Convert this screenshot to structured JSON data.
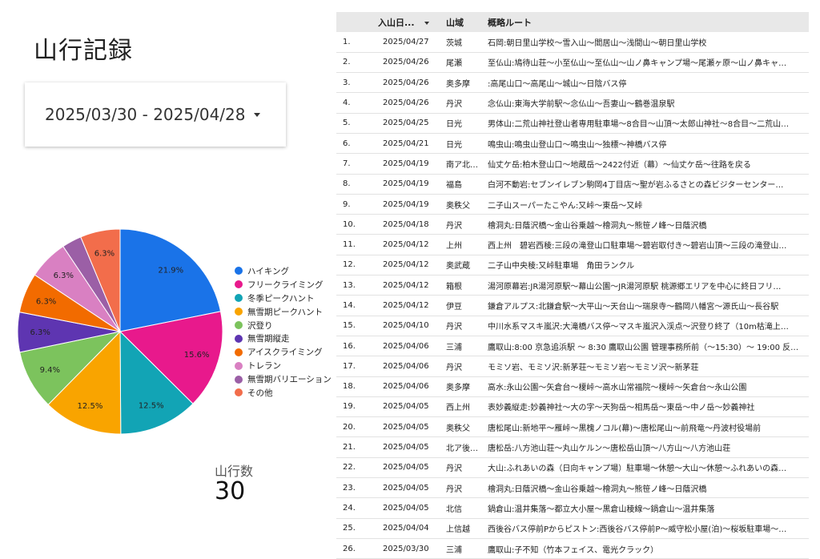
{
  "page": {
    "title": "山行記録"
  },
  "date_range": {
    "value": "2025/03/30 - 2025/04/28"
  },
  "summary": {
    "label": "山行数",
    "value": "30"
  },
  "chart_data": {
    "type": "pie",
    "slices": [
      {
        "name": "ハイキング",
        "value": 21.9,
        "label": "21.9%",
        "color": "#1a73e8"
      },
      {
        "name": "フリークライミング",
        "value": 15.6,
        "label": "15.6%",
        "color": "#e8198c"
      },
      {
        "name": "冬季ピークハント",
        "value": 12.5,
        "label": "12.5%",
        "color": "#12a4b5"
      },
      {
        "name": "無雪期ピークハント",
        "value": 12.5,
        "label": "12.5%",
        "color": "#f9a400"
      },
      {
        "name": "沢登り",
        "value": 9.4,
        "label": "9.4%",
        "color": "#7cc35d"
      },
      {
        "name": "無雪期縦走",
        "value": 6.3,
        "label": "6.3%",
        "color": "#5e35b1"
      },
      {
        "name": "アイスクライミング",
        "value": 6.3,
        "label": "6.3%",
        "color": "#f26b00"
      },
      {
        "name": "トレラン",
        "value": 6.3,
        "label": "6.3%",
        "color": "#d980c2"
      },
      {
        "name": "無雪期バリエーション",
        "value": 3.1,
        "label": "",
        "color": "#9b5fa6"
      },
      {
        "name": "その他",
        "value": 6.3,
        "label": "6.3%",
        "color": "#f26d4b"
      }
    ]
  },
  "table": {
    "headers": [
      "",
      "入山日...",
      "山域",
      "概略ルート"
    ],
    "rows": [
      [
        "1.",
        "2025/04/27",
        "茨城",
        "石岡:朝日里山学校〜雪入山〜閻居山〜浅間山〜朝日里山学校"
      ],
      [
        "2.",
        "2025/04/26",
        "尾瀬",
        "至仏山:鳩待山荘〜小至仏山〜至仏山〜山ノ鼻キャンプ場〜尾瀬ヶ原〜山ノ鼻キャ…"
      ],
      [
        "3.",
        "2025/04/26",
        "奥多摩",
        ":高尾山口〜高尾山〜城山〜日陰バス停"
      ],
      [
        "4.",
        "2025/04/26",
        "丹沢",
        "念仏山:東海大学前駅〜念仏山〜吾妻山〜鶴巻温泉駅"
      ],
      [
        "5.",
        "2025/04/25",
        "日光",
        "男体山:二荒山神社登山者専用駐車場〜8合目〜山頂〜太郎山神社〜8合目〜二荒山…"
      ],
      [
        "6.",
        "2025/04/21",
        "日光",
        "鳴虫山:鳴虫山登山口〜鳴虫山〜独標〜神橋バス停"
      ],
      [
        "7.",
        "2025/04/19",
        "南ア北…",
        "仙丈ケ岳:柏木登山口〜地蔵岳〜2422付近（幕）〜仙丈ケ岳〜往路を戻る"
      ],
      [
        "8.",
        "2025/04/19",
        "福島",
        "白河不動岩:セブンイレブン駒岡4丁目店〜聖が岩ふるさとの森ビジターセンター…"
      ],
      [
        "9.",
        "2025/04/19",
        "奥秩父",
        "二子山スーパーたこやん:又峠〜東岳〜又峠"
      ],
      [
        "10.",
        "2025/04/18",
        "丹沢",
        "檜洞丸:日蔭沢橋〜金山谷乗越〜檜洞丸〜熊笹ノ峰〜日蔭沢橋"
      ],
      [
        "11.",
        "2025/04/12",
        "上州",
        "西上州　碧岩西稜:三段の滝登山口駐車場〜碧岩取付き〜碧岩山頂〜三段の滝登山…"
      ],
      [
        "12.",
        "2025/04/12",
        "奥武蔵",
        "二子山中央稜:又峠駐車場　角田ランクル"
      ],
      [
        "13.",
        "2025/04/12",
        "箱根",
        "湯河原幕岩:JR湯河原駅〜幕山公園〜JR湯河原駅 桃源郷エリアを中心に終日フリ…"
      ],
      [
        "14.",
        "2025/04/12",
        "伊豆",
        "鎌倉アルプス:北鎌倉駅〜大平山〜天台山〜瑞泉寺〜鶴岡八幡宮〜源氏山〜長谷駅"
      ],
      [
        "15.",
        "2025/04/10",
        "丹沢",
        "中川水系マスキ嵐沢:大滝橋バス停〜マスキ嵐沢入渓点〜沢登り終了（10m枯滝上…"
      ],
      [
        "16.",
        "2025/04/06",
        "三浦",
        "鷹取山:8:00 京急追浜駅 〜 8:30 鷹取山公園 管理事務所前（〜15:30）〜 19:00 反…"
      ],
      [
        "17.",
        "2025/04/06",
        "丹沢",
        "モミソ岩、モミソ沢:新茅荘〜モミソ岩〜モミソ沢〜新茅荘"
      ],
      [
        "18.",
        "2025/04/06",
        "奥多摩",
        "高水:永山公園〜矢倉台〜榎峠〜高水山常福院〜榎峠〜矢倉台〜永山公園"
      ],
      [
        "19.",
        "2025/04/05",
        "西上州",
        "表妙義縦走:妙義神社〜大の字〜天狗岳〜相馬岳〜東岳〜中ノ岳〜妙義神社"
      ],
      [
        "20.",
        "2025/04/05",
        "奥秩父",
        "唐松尾山:新地平〜雁峠〜黒槐ノコル(幕)〜唐松尾山〜前飛竜〜丹波村役場前"
      ],
      [
        "21.",
        "2025/04/05",
        "北ア後…",
        "唐松岳:八方池山荘〜丸山ケルン〜唐松岳山頂〜八方山〜八方池山荘"
      ],
      [
        "22.",
        "2025/04/05",
        "丹沢",
        "大山:ふれあいの森（日向キャンプ場）駐車場〜休憩〜大山〜休憩〜ふれあいの森…"
      ],
      [
        "23.",
        "2025/04/05",
        "丹沢",
        "檜洞丸:日蔭沢橋〜金山谷乗越〜檜洞丸〜熊笹ノ峰〜日蔭沢橋"
      ],
      [
        "24.",
        "2025/04/05",
        "北信",
        "鍋倉山:温井集落〜都立大小屋〜黒倉山稜線〜鍋倉山〜温井集落"
      ],
      [
        "25.",
        "2025/04/04",
        "上信越",
        "西後谷バス停前Pからピストン:西後谷バス停前P〜威守松小屋(泊)〜桜坂駐車場〜…"
      ],
      [
        "26.",
        "2025/03/30",
        "三浦",
        "鷹取山:子不知（竹本フェイス、電光クラック）"
      ]
    ]
  }
}
